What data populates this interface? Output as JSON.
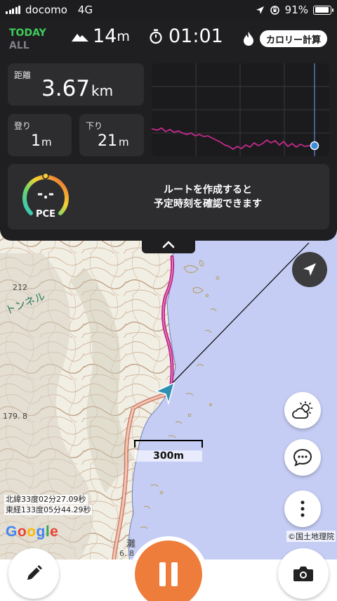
{
  "status_bar": {
    "carrier": "docomo",
    "network": "4G",
    "battery": "91%",
    "battery_level": 0.91
  },
  "panel": {
    "scope_today": "TODAY",
    "scope_all": "ALL",
    "elevation_value": "14",
    "elevation_unit": "m",
    "timer_value": "01:01",
    "calorie_button": "カロリー計算",
    "distance_label": "距離",
    "distance_value": "3.67",
    "distance_unit": "km",
    "ascent_label": "登り",
    "ascent_value": "1",
    "ascent_unit": "m",
    "descent_label": "下り",
    "descent_value": "21",
    "descent_unit": "m",
    "pce_value": "-.-",
    "pce_label": "PCE",
    "route_message_line1": "ルートを作成すると",
    "route_message_line2": "予定時刻を確認できます"
  },
  "map": {
    "latitude": "北緯33度02分27.09秒",
    "longitude": "東経133度05分44.29秒",
    "scale_label": "300m",
    "google_logo": "Google",
    "attribution": "©国土地理院",
    "spot_height_1": "212",
    "spot_height_2": "179. 8",
    "spot_height_3": "6. 8",
    "place_label": "灘",
    "tunnel_label": "トンネル"
  },
  "accent": "#c32a8c",
  "record_color": "#ee7d3b",
  "icons": {
    "elevation": "mountain-icon",
    "timer": "stopwatch-icon",
    "calorie": "flame-icon",
    "location": "navigation-arrow-icon",
    "weather": "partly-cloudy-icon",
    "chat": "chat-bubble-icon",
    "more": "more-vertical-icon",
    "edit": "pencil-icon",
    "pause": "pause-icon",
    "camera": "camera-icon"
  }
}
